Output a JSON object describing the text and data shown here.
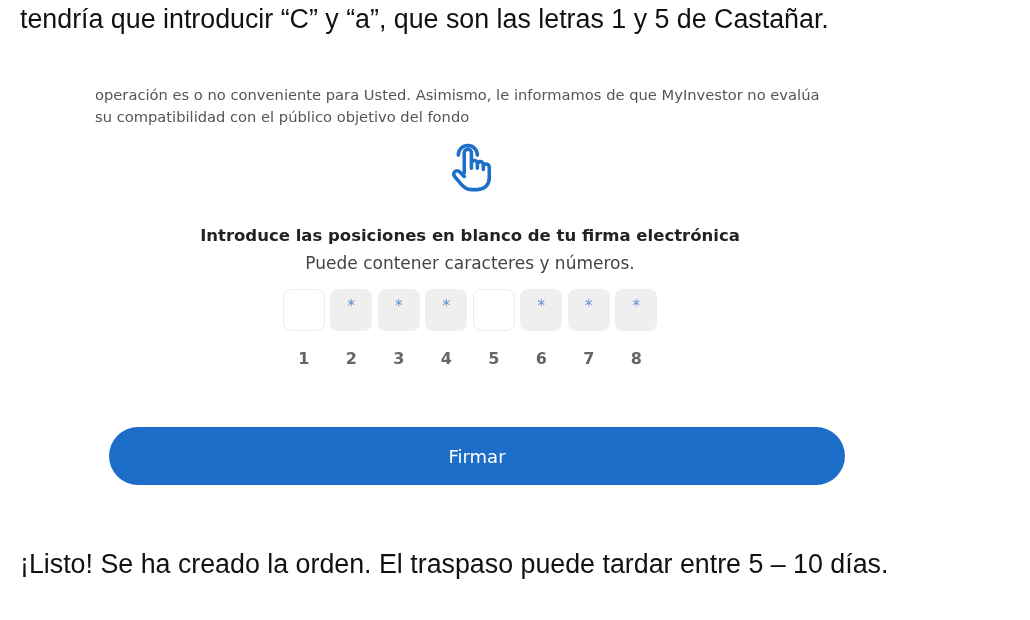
{
  "intro_text": "tendría que introducir “C” y “a”, que son las letras 1 y 5 de Castañar.",
  "signature_screen": {
    "disclaimer": "operación es o no conveniente para Usted. Asimismo, le informamos de que MyInvestor no evalúa su compatibilidad con el público objetivo del fondo",
    "heading": "Introduce las posiciones en blanco de tu firma electrónica",
    "hint": "Puede contener caracteres y números.",
    "positions": [
      {
        "kind": "blank",
        "number": "1"
      },
      {
        "kind": "masked",
        "mask": "*",
        "number": "2"
      },
      {
        "kind": "masked",
        "mask": "*",
        "number": "3"
      },
      {
        "kind": "masked",
        "mask": "*",
        "number": "4"
      },
      {
        "kind": "blank",
        "number": "5"
      },
      {
        "kind": "masked",
        "mask": "*",
        "number": "6"
      },
      {
        "kind": "masked",
        "mask": "*",
        "number": "7"
      },
      {
        "kind": "masked",
        "mask": "*",
        "number": "8"
      }
    ],
    "sign_button": "Firmar"
  },
  "outro_text": "¡Listo! Se ha creado la orden. El traspaso puede tardar entre 5 – 10 días."
}
